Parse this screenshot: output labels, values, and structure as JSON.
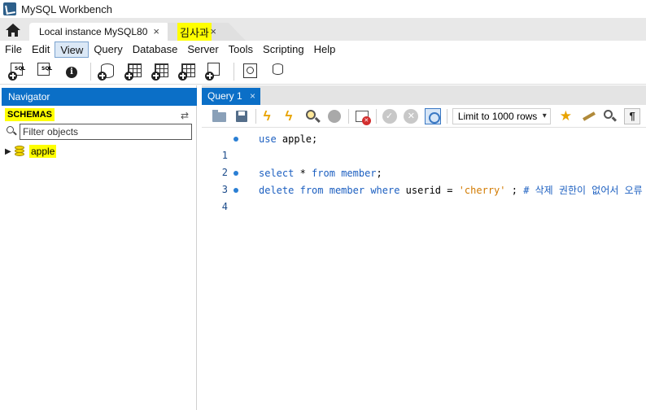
{
  "window": {
    "title": "MySQL Workbench"
  },
  "connection_tabs": [
    {
      "label": "Local instance MySQL80",
      "close": "×"
    },
    {
      "label": "김사과",
      "close": "×"
    }
  ],
  "menu": [
    "File",
    "Edit",
    "View",
    "Query",
    "Database",
    "Server",
    "Tools",
    "Scripting",
    "Help"
  ],
  "menu_active": "View",
  "toolbar": {
    "new_sql_tab_text": "SQL",
    "open_sql_text": "SQL",
    "icons": [
      "new-sql-tab-icon",
      "open-sql-script-icon",
      "inspector-icon",
      "create-schema-icon",
      "create-table-icon",
      "create-view-icon",
      "create-procedure-icon",
      "create-function-icon",
      "search-table-data-icon",
      "reconnect-icon"
    ]
  },
  "navigator": {
    "title": "Navigator",
    "schemas_label": "SCHEMAS",
    "filter_placeholder": "Filter objects",
    "schemas": [
      {
        "name": "apple"
      }
    ]
  },
  "query_tab": {
    "label": "Query 1",
    "close": "×"
  },
  "query_toolbar": {
    "limit_label": "Limit to 1000 rows"
  },
  "editor": {
    "line_numbers": [
      "1",
      "2",
      "3",
      "4"
    ],
    "lines": [
      {
        "tokens": [
          {
            "t": "use",
            "k": "kw"
          },
          {
            "t": " apple;",
            "k": "plain"
          }
        ]
      },
      {
        "tokens": []
      },
      {
        "tokens": [
          {
            "t": "select",
            "k": "kw"
          },
          {
            "t": " * ",
            "k": "plain"
          },
          {
            "t": "from",
            "k": "kw"
          },
          {
            "t": " ",
            "k": "plain"
          },
          {
            "t": "member",
            "k": "kw"
          },
          {
            "t": ";",
            "k": "plain"
          }
        ]
      },
      {
        "tokens": [
          {
            "t": "delete",
            "k": "kw"
          },
          {
            "t": " ",
            "k": "plain"
          },
          {
            "t": "from",
            "k": "kw"
          },
          {
            "t": " ",
            "k": "plain"
          },
          {
            "t": "member",
            "k": "kw"
          },
          {
            "t": " ",
            "k": "plain"
          },
          {
            "t": "where",
            "k": "kw"
          },
          {
            "t": " userid = ",
            "k": "plain"
          },
          {
            "t": "'cherry'",
            "k": "str"
          },
          {
            "t": " ; ",
            "k": "plain"
          },
          {
            "t": "# 삭제 권한이 없어서 오류",
            "k": "cm"
          }
        ]
      }
    ]
  },
  "colors": {
    "accent_blue": "#0b6fc7",
    "highlight_yellow": "#ffff00",
    "keyword_blue": "#1c5fc0",
    "string_orange": "#d27a00"
  }
}
